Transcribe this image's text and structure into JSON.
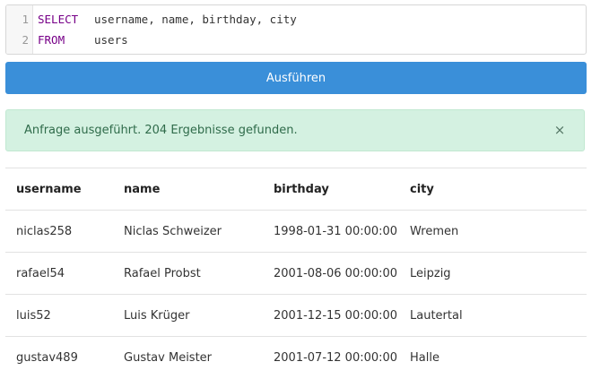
{
  "editor": {
    "lines": [
      {
        "num": "1",
        "keyword": "SELECT",
        "rest": "username, name, birthday, city"
      },
      {
        "num": "2",
        "keyword": "FROM",
        "rest": "users"
      }
    ]
  },
  "toolbar": {
    "run_label": "Ausführen"
  },
  "alert": {
    "message": "Anfrage ausgeführt. 204 Ergebnisse gefunden.",
    "close_glyph": "×"
  },
  "table": {
    "headers": [
      "username",
      "name",
      "birthday",
      "city"
    ],
    "rows": [
      [
        "niclas258",
        "Niclas Schweizer",
        "1998-01-31 00:00:00",
        "Wremen"
      ],
      [
        "rafael54",
        "Rafael Probst",
        "2001-08-06 00:00:00",
        "Leipzig"
      ],
      [
        "luis52",
        "Luis Krüger",
        "2001-12-15 00:00:00",
        "Lautertal"
      ],
      [
        "gustav489",
        "Gustav Meister",
        "2001-07-12 00:00:00",
        "Halle"
      ]
    ]
  },
  "colors": {
    "primary": "#3a8fd9",
    "success_bg": "#d4f1e1",
    "keyword": "#770088"
  }
}
